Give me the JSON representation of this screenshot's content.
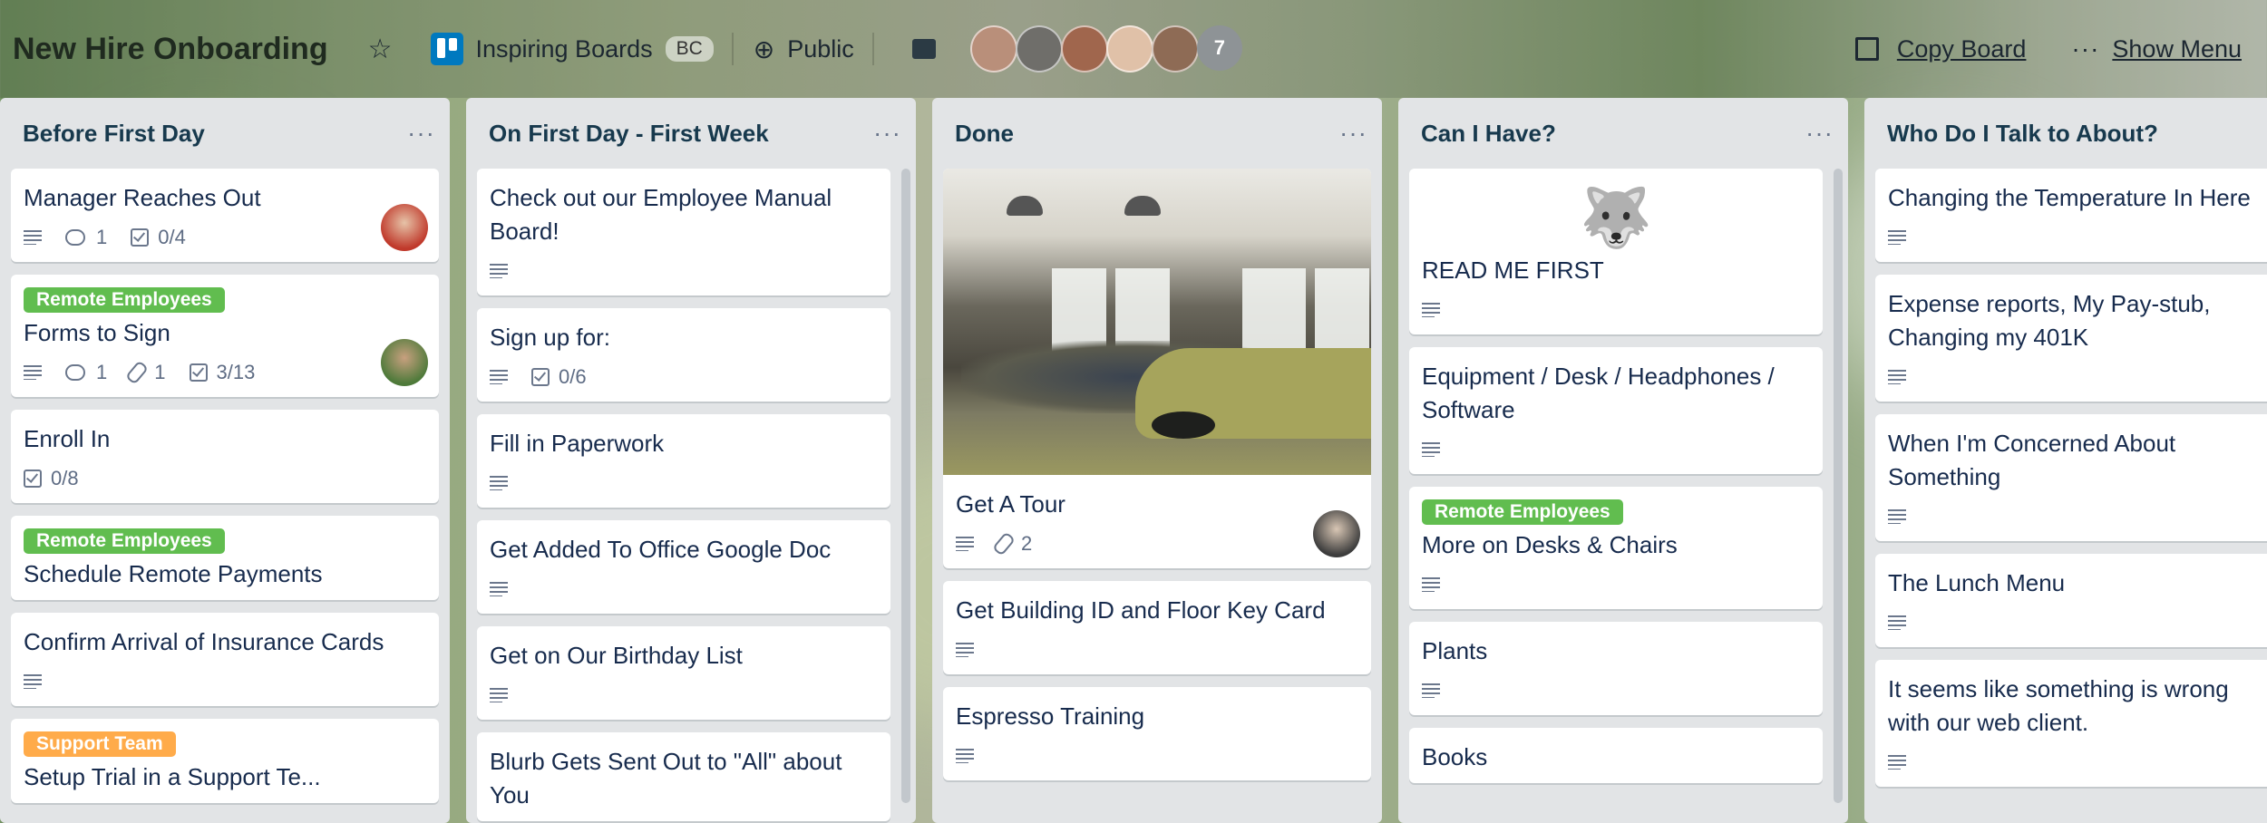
{
  "header": {
    "board_title": "New Hire Onboarding",
    "team_name": "Inspiring Boards",
    "team_badge": "BC",
    "visibility": "Public",
    "member_count": "7",
    "copy_board": "Copy Board",
    "show_menu": "Show Menu"
  },
  "lists": [
    {
      "title": "Before First Day",
      "cards": [
        {
          "title": "Manager Reaches Out",
          "comments": "1",
          "checklist": "0/4"
        },
        {
          "label": "Remote Employees",
          "title": "Forms to Sign",
          "comments": "1",
          "attachments": "1",
          "checklist": "3/13"
        },
        {
          "title": "Enroll In",
          "checklist": "0/8"
        },
        {
          "label": "Remote Employees",
          "title": "Schedule Remote Payments"
        },
        {
          "title": "Confirm Arrival of Insurance Cards"
        },
        {
          "label": "Support Team",
          "title": "Setup Trial in a Support Te..."
        }
      ]
    },
    {
      "title": "On First Day - First Week",
      "cards": [
        {
          "title": "Check out our Employee Manual Board!"
        },
        {
          "title": "Sign up for:",
          "checklist": "0/6"
        },
        {
          "title": "Fill in Paperwork"
        },
        {
          "title": "Get Added To Office Google Doc"
        },
        {
          "title": "Get on Our Birthday List"
        },
        {
          "title": "Blurb Gets Sent Out to \"All\" about You"
        }
      ]
    },
    {
      "title": "Done",
      "cards": [
        {
          "title": "Get A Tour",
          "attachments": "2"
        },
        {
          "title": "Get Building ID and Floor Key Card"
        },
        {
          "title": "Espresso Training"
        }
      ]
    },
    {
      "title": "Can I Have?",
      "cards": [
        {
          "title": "READ ME FIRST"
        },
        {
          "title": "Equipment / Desk / Headphones / Software"
        },
        {
          "label": "Remote Employees",
          "title": "More on Desks & Chairs"
        },
        {
          "title": "Plants"
        },
        {
          "title": "Books"
        }
      ]
    },
    {
      "title": "Who Do I Talk to About?",
      "cards": [
        {
          "title": "Changing the Temperature In Here"
        },
        {
          "title": "Expense reports, My Pay-stub, Changing my 401K"
        },
        {
          "title": "When I'm Concerned About Something"
        },
        {
          "title": "The Lunch Menu"
        },
        {
          "title": "It seems like something is wrong with our web client."
        }
      ]
    }
  ],
  "colors": {
    "label_green": "#61bd4f",
    "label_orange": "#ffab4a",
    "list_bg": "#e2e4e6",
    "team_icon": "#0079bf"
  },
  "icons": [
    "star-icon",
    "boards-icon",
    "globe-icon",
    "archive-icon",
    "copy-icon",
    "more-icon",
    "description-icon",
    "comment-icon",
    "checklist-icon",
    "attachment-icon",
    "husky-mascot-icon"
  ]
}
